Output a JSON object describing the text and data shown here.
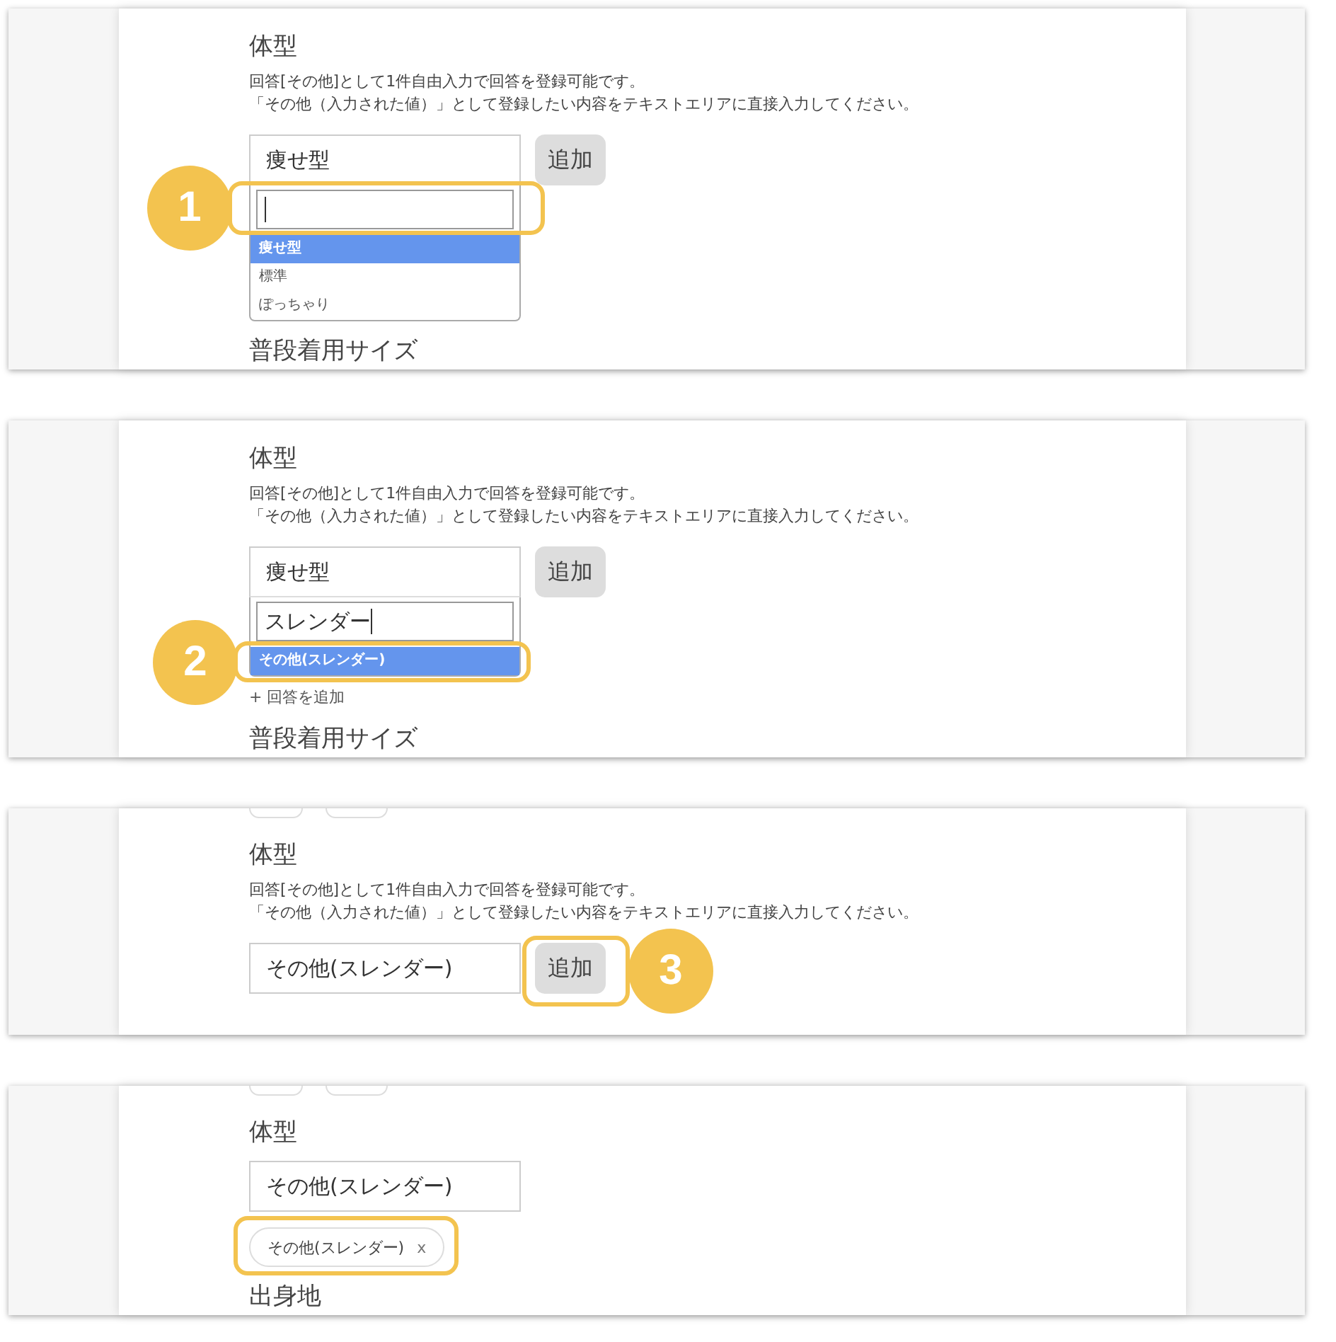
{
  "steps": [
    {
      "step_badge": "1",
      "top_chip_edges": false,
      "title": "体型",
      "help_lines": [
        "回答[その他]として1件自由入力で回答を登録可能です。",
        "「その他（入力された値）」として登録したい内容をテキストエリアに直接入力してください。"
      ],
      "select": {
        "value": "痩せ型"
      },
      "add_button": {
        "label": "追加"
      },
      "dropdown": {
        "search": {
          "focused": true,
          "highlighted": true
        },
        "options": [
          {
            "label": "痩せ型",
            "selected": true,
            "highlighted": false
          },
          {
            "label": "標準",
            "selected": false,
            "highlighted": false
          },
          {
            "label": "ぽっちゃり",
            "selected": false,
            "highlighted": false
          }
        ]
      },
      "next_title": "普段着用サイズ"
    },
    {
      "step_badge": "2",
      "top_chip_edges": false,
      "title": "体型",
      "help_lines": [
        "回答[その他]として1件自由入力で回答を登録可能です。",
        "「その他（入力された値）」として登録したい内容をテキストエリアに直接入力してください。"
      ],
      "select": {
        "value": "痩せ型"
      },
      "add_button": {
        "label": "追加"
      },
      "dropdown": {
        "search": {
          "value": "スレンダー",
          "focused": true,
          "highlighted": false
        },
        "options": [
          {
            "label": "その他(スレンダー)",
            "selected": true,
            "highlighted": true
          }
        ]
      },
      "add_link": "+ 回答を追加",
      "next_title": "普段着用サイズ"
    },
    {
      "step_badge": "3",
      "top_chip_edges": true,
      "title": "体型",
      "help_lines": [
        "回答[その他]として1件自由入力で回答を登録可能です。",
        "「その他（入力された値）」として登録したい内容をテキストエリアに直接入力してください。"
      ],
      "select": {
        "value": "その他(スレンダー)"
      },
      "add_button": {
        "label": "追加",
        "highlighted": true
      }
    },
    {
      "top_chip_edges": true,
      "title": "体型",
      "select": {
        "value": "その他(スレンダー)"
      },
      "chips": [
        {
          "label": "その他(スレンダー)",
          "remove": "x",
          "highlighted": true
        }
      ],
      "next_title": "出身地"
    }
  ]
}
